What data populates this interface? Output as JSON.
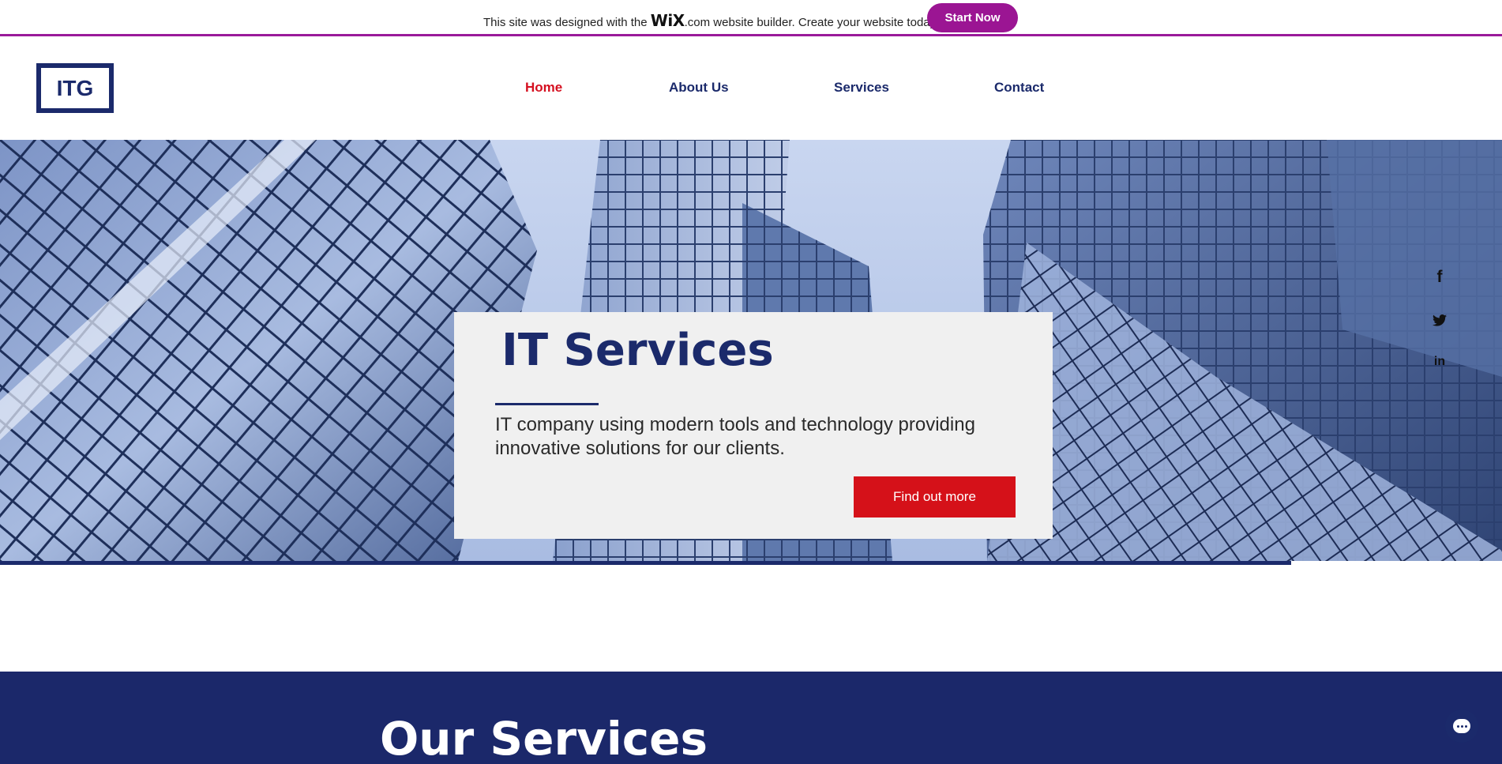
{
  "wix_banner": {
    "text_before": "This site was designed with the ",
    "logo": "WiX",
    "dotcom": ".com",
    "text_after": " website builder. Create your website today.",
    "button": "Start Now"
  },
  "header": {
    "logo": "ITG",
    "nav": [
      "Home",
      "About Us",
      "Services",
      "Contact"
    ],
    "active": "Home"
  },
  "hero": {
    "title": "IT Services",
    "description": "IT company using modern tools and technology providing innovative solutions for our clients.",
    "button": "Find out more"
  },
  "social": {
    "facebook": "f",
    "twitter": "🐦",
    "linkedin": "in"
  },
  "services": {
    "title": "Our Services"
  },
  "colors": {
    "brand_navy": "#1b2a6b",
    "accent_red": "#d51119",
    "wix_purple": "#9b1593"
  }
}
